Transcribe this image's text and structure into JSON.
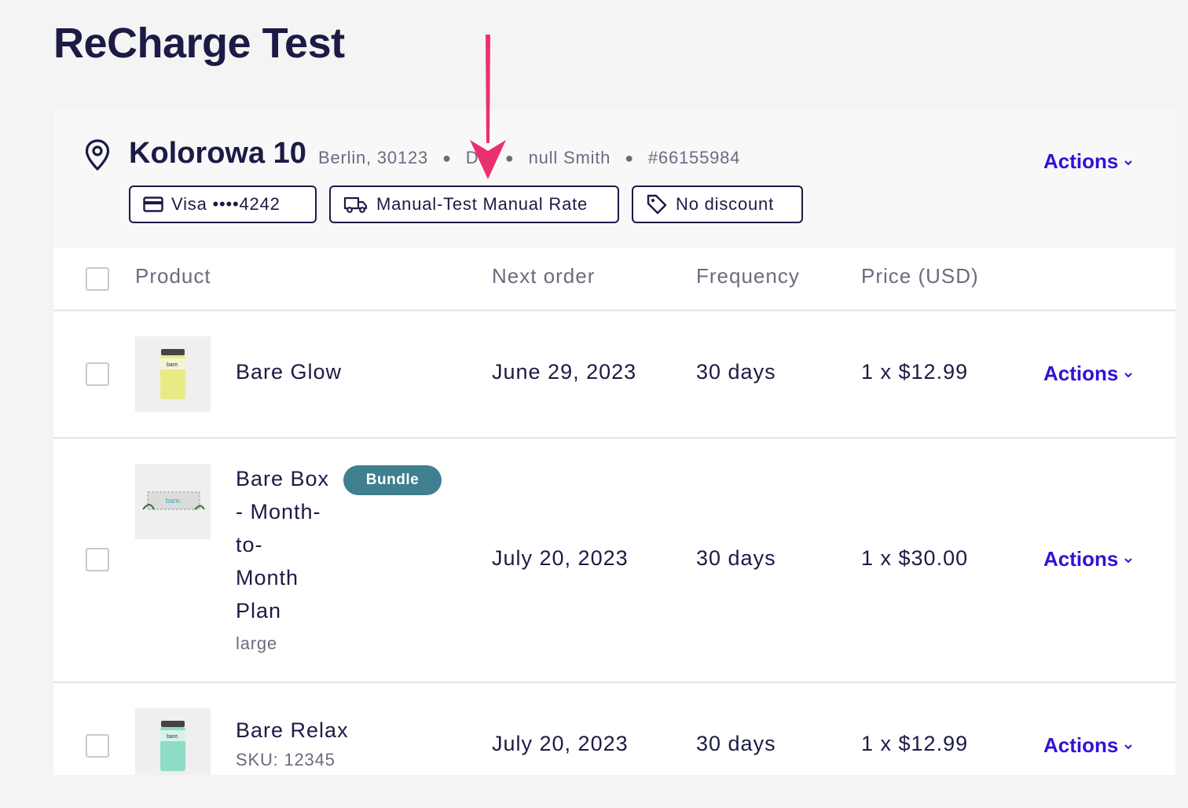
{
  "page": {
    "title": "ReCharge Test"
  },
  "address": {
    "line": "Kolorowa 10",
    "city": "Berlin, 30123",
    "country": "DE",
    "customer": "null Smith",
    "id": "#66155984",
    "actions_label": "Actions"
  },
  "pills": {
    "payment": "Visa ••••4242",
    "shipping": "Manual-Test Manual Rate",
    "discount": "No discount"
  },
  "table": {
    "headers": {
      "product": "Product",
      "next_order": "Next order",
      "frequency": "Frequency",
      "price": "Price (USD)"
    },
    "rows": [
      {
        "name": "Bare Glow",
        "variant": "",
        "next_order": "June 29, 2023",
        "frequency": "30 days",
        "price": "1 x $12.99",
        "actions": "Actions",
        "thumb_color": "#e9ea86"
      },
      {
        "name_lines": [
          "Bare Box",
          "- Month-",
          "to-",
          "Month",
          "Plan"
        ],
        "variant": "large",
        "badge": "Bundle",
        "next_order": "July 20, 2023",
        "frequency": "30 days",
        "price": "1 x $30.00",
        "actions": "Actions"
      },
      {
        "name": "Bare Relax",
        "variant": "SKU: 12345",
        "next_order": "July 20, 2023",
        "frequency": "30 days",
        "price": "1 x $12.99",
        "actions": "Actions",
        "thumb_color": "#8fdcc6"
      }
    ]
  },
  "colors": {
    "accent": "#3311d6",
    "text": "#1b1b45",
    "badge": "#3f7f8f",
    "arrow": "#ec2f6e"
  },
  "annotation": {
    "icon": "arrow-down-icon"
  }
}
